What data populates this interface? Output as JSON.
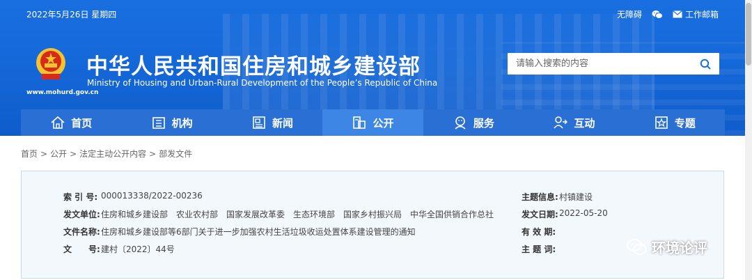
{
  "topbar": {
    "date": "2022年5月26日 星期四",
    "accessibility": "无障碍",
    "mail": "工作邮箱"
  },
  "header": {
    "url": "www.mohurd.gov.cn",
    "title_cn": "中华人民共和国住房和城乡建设部",
    "title_en": "Ministry of Housing and Urban-Rural Development of the People’s Republic of China"
  },
  "search": {
    "placeholder": "请输入搜索的内容"
  },
  "nav": [
    {
      "label": "首页",
      "icon": "home-icon"
    },
    {
      "label": "机构",
      "icon": "building-icon"
    },
    {
      "label": "新闻",
      "icon": "news-icon"
    },
    {
      "label": "公开",
      "icon": "document-icon",
      "active": true
    },
    {
      "label": "服务",
      "icon": "service-icon"
    },
    {
      "label": "互动",
      "icon": "interaction-icon"
    },
    {
      "label": "专题",
      "icon": "topic-icon"
    }
  ],
  "breadcrumb": [
    "首页",
    "公开",
    "法定主动公开内容",
    "部发文件"
  ],
  "info": {
    "index_label": "索 引 号:",
    "index_value": "000013338/2022-00236",
    "unit_label": "发文单位:",
    "unit_value": "住房和城乡建设部　农业农村部　国家发展改革委　生态环境部　国家乡村振兴局　中华全国供销合作总社",
    "name_label": "文件名称:",
    "name_value": "住房和城乡建设部等6部门关于进一步加强农村生活垃圾收运处置体系建设管理的通知",
    "doc_label": "文　　号:",
    "doc_value": "建村〔2022〕44号",
    "topic_label": "主题信息:",
    "topic_value": "村镇建设",
    "date_label": "发文日期:",
    "date_value": "2022-05-20",
    "validity_label": "有 效 期:",
    "validity_value": "",
    "keywords_label": "主 题 词:",
    "keywords_value": ""
  },
  "watermark": {
    "text": "环境论评"
  },
  "colors": {
    "primary": "#1568d8",
    "nav": "#2a6fd3",
    "nav_active": "#3d86e6",
    "panel": "#f3f8fd"
  }
}
